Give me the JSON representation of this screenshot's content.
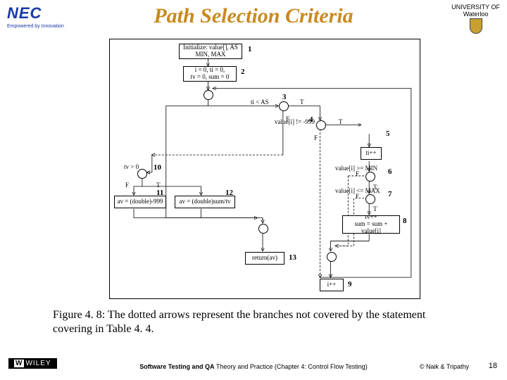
{
  "title": "Path Selection Criteria",
  "logos": {
    "nec": {
      "brand": "NEC",
      "tagline": "Empowered by Innovation"
    },
    "waterloo": {
      "line1": "UNIVERSITY OF",
      "line2": "Waterloo"
    },
    "wiley": "WILEY"
  },
  "diagram": {
    "node1": "Initialize: value[], AS\nMIN, MAX",
    "node2": "i = 0, ti = 0,\ntv = 0, sum = 0",
    "cond3": "ti  <  AS",
    "cond4": "value[i] != -999",
    "node5": "ti++",
    "cond6": "value[i] >= MIN",
    "cond7": "value[i] <= MAX",
    "node8": "tv++\nsum = sum + value[i]",
    "node9": "i++",
    "cond10": "tv > 0",
    "node11": "av = (double)-999",
    "node12": "av = (double)sum/tv",
    "node13": "return(av)",
    "labels": {
      "T": "T",
      "F": "F"
    },
    "nums": {
      "n1": "1",
      "n2": "2",
      "n3": "3",
      "n4": "4",
      "n5": "5",
      "n6": "6",
      "n7": "7",
      "n8": "8",
      "n9": "9",
      "n10": "10",
      "n11": "11",
      "n12": "12",
      "n13": "13"
    }
  },
  "caption": "Figure 4. 8: The dotted arrows represent the branches not covered by the statement covering in Table 4. 4.",
  "footer": {
    "center_bold": "Software Testing and QA",
    "center_rest": " Theory and Practice (Chapter 4: Control Flow Testing)",
    "right": "© Naik & Tripathy",
    "page": "18"
  }
}
